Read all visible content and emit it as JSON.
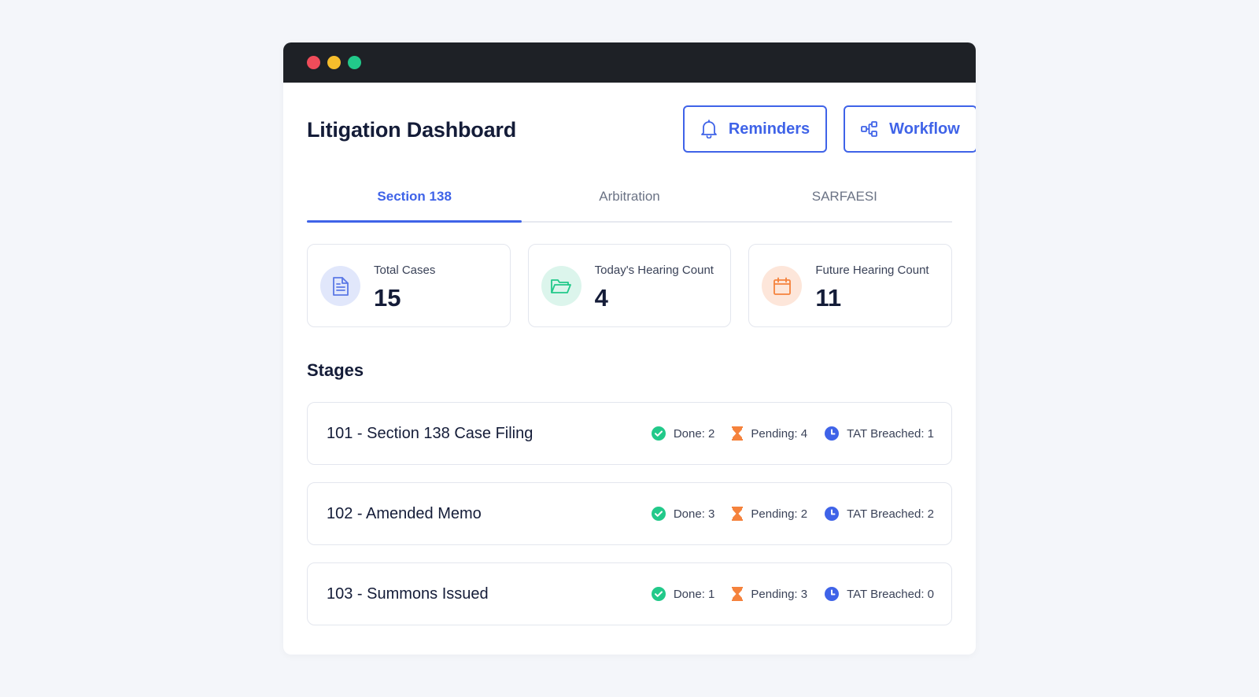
{
  "header": {
    "title": "Litigation Dashboard",
    "reminders_label": "Reminders",
    "workflow_label": "Workflow"
  },
  "tabs": [
    {
      "label": "Section 138",
      "active": true
    },
    {
      "label": "Arbitration",
      "active": false
    },
    {
      "label": "SARFAESI",
      "active": false
    }
  ],
  "stats": [
    {
      "label": "Total Cases",
      "value": "15",
      "icon": "document-icon",
      "color": "#5b78e6"
    },
    {
      "label": "Today's Hearing Count",
      "value": "4",
      "icon": "folder-open-icon",
      "color": "#22c98a"
    },
    {
      "label": "Future Hearing Count",
      "value": "11",
      "icon": "calendar-icon",
      "color": "#f5823c"
    }
  ],
  "stages_title": "Stages",
  "stages": [
    {
      "name": "101 - Section 138 Case Filing",
      "done": "Done: 2",
      "pending": "Pending: 4",
      "tat": "TAT Breached: 1"
    },
    {
      "name": "102 - Amended Memo",
      "done": "Done: 3",
      "pending": "Pending: 2",
      "tat": "TAT Breached: 2"
    },
    {
      "name": "103 - Summons Issued",
      "done": "Done: 1",
      "pending": "Pending: 3",
      "tat": "TAT Breached: 0"
    }
  ],
  "colors": {
    "accent": "#3f63e8",
    "done": "#22c98a",
    "pending": "#f5823c",
    "tat": "#3f63e8"
  }
}
